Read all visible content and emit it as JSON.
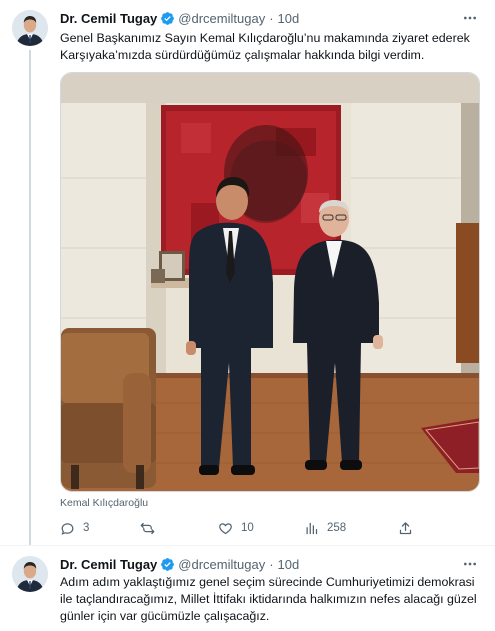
{
  "tweets": [
    {
      "author_name": "Dr. Cemil Tugay",
      "handle": "@drcemiltugay",
      "separator": "·",
      "time": "10d",
      "text": "Genel Başkanımız Sayın Kemal Kılıçdaroğlu’nu makamında ziyaret ederek Karşıyaka’mızda sürdürdüğümüz çalışmalar hakkında bilgi verdim.",
      "media_caption": "Kemal Kılıçdaroğlu",
      "actions": {
        "replies": "3",
        "retweets": "",
        "likes": "10",
        "views": "258"
      }
    },
    {
      "author_name": "Dr. Cemil Tugay",
      "handle": "@drcemiltugay",
      "separator": "·",
      "time": "10d",
      "text": "Adım adım yaklaştığımız genel seçim sürecinde Cumhuriyetimizi demokrasi ile taçlandıracağımız, Millet İttifakı iktidarında halkımızın nefes alacağı güzel günler için var gücümüzle çalışacağız."
    }
  ],
  "icons": {
    "verified": "verified-badge-icon",
    "more": "more-icon",
    "reply": "reply-icon",
    "retweet": "retweet-icon",
    "like": "like-icon",
    "views": "views-icon",
    "share": "share-icon"
  },
  "colors": {
    "accent": "#1d9bf0",
    "text": "#0f1419",
    "secondary": "#536471",
    "thread_line": "#cfd9de"
  }
}
